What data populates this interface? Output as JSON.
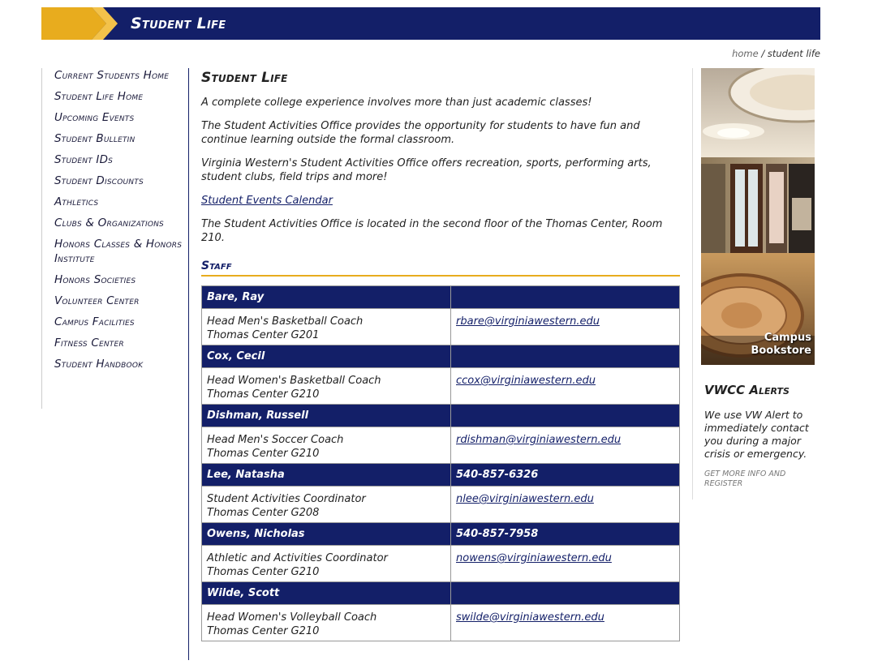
{
  "header": {
    "title": "Student Life"
  },
  "breadcrumb": {
    "home": "home",
    "sep": " / ",
    "current": "student life"
  },
  "leftnav": {
    "items": [
      "Current Students Home",
      "Student Life Home",
      "Upcoming Events",
      "Student Bulletin",
      "Student IDs",
      "Student Discounts",
      "Athletics",
      "Clubs & Organizations",
      "Honors Classes & Honors Institute",
      "Honors Societies",
      "Volunteer Center",
      "Campus Facilities",
      "Fitness Center",
      "Student Handbook"
    ]
  },
  "main": {
    "title": "Student Life",
    "p1": "A complete college experience involves more than just academic classes!",
    "p2": "The Student Activities Office provides the opportunity for students to have fun and continue learning outside the formal classroom.",
    "p3": "Virginia Western's Student Activities Office offers recreation, sports, performing arts, student clubs, field trips and more!",
    "calendar_link": "Student Events Calendar",
    "p4": "The Student Activities Office is located in the second floor of the Thomas Center, Room 210.",
    "staff_heading": "Staff",
    "staff": [
      {
        "name": "Bare, Ray",
        "phone": "",
        "title": "Head Men's Basketball Coach",
        "location": "Thomas Center G201",
        "email": "rbare@virginiawestern.edu"
      },
      {
        "name": "Cox, Cecil",
        "phone": "",
        "title": "Head Women's Basketball Coach",
        "location": "Thomas Center G210",
        "email": "ccox@virginiawestern.edu"
      },
      {
        "name": "Dishman, Russell",
        "phone": "",
        "title": "Head Men's Soccer Coach",
        "location": "Thomas Center G210",
        "email": "rdishman@virginiawestern.edu"
      },
      {
        "name": "Lee, Natasha",
        "phone": "540-857-6326",
        "title": "Student Activities Coordinator",
        "location": "Thomas Center G208",
        "email": "nlee@virginiawestern.edu"
      },
      {
        "name": "Owens, Nicholas",
        "phone": "540-857-7958",
        "title": "Athletic and Activities Coordinator",
        "location": "Thomas Center G210",
        "email": "nowens@virginiawestern.edu"
      },
      {
        "name": "Wilde, Scott",
        "phone": "",
        "title": "Head Women's Volleyball Coach",
        "location": "Thomas Center G210",
        "email": "swilde@virginiawestern.edu"
      }
    ]
  },
  "sidebar": {
    "bookstore_line1": "Campus",
    "bookstore_line2": "Bookstore",
    "alerts_title": "VWCC Alerts",
    "alerts_text": "We use VW Alert to immediately contact you during a major crisis or emergency.",
    "alerts_link": "Get more info and register"
  },
  "colors": {
    "navy": "#131f68",
    "gold": "#e8ac1e"
  }
}
